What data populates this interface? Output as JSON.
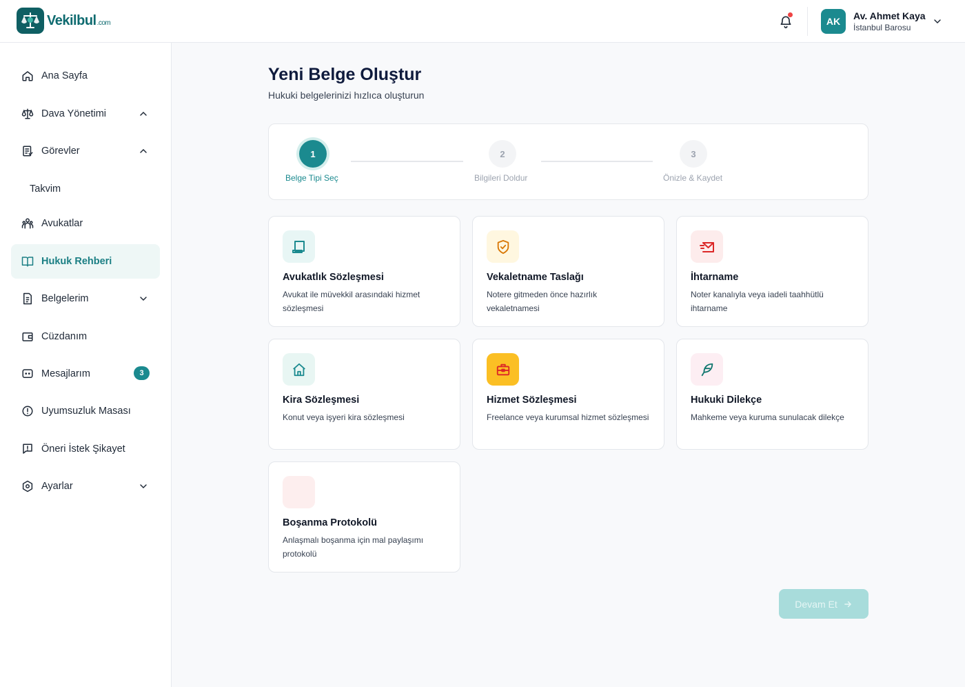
{
  "header": {
    "logo_text": "Vekilbul",
    "logo_suffix": ".com",
    "user": {
      "initials": "AK",
      "name": "Av. Ahmet Kaya",
      "subtitle": "İstanbul Barosu"
    }
  },
  "sidebar": {
    "items": [
      {
        "label": "Ana Sayfa",
        "icon": "home-icon"
      },
      {
        "label": "Dava Yönetimi",
        "icon": "scale-icon",
        "chevron": "up"
      },
      {
        "label": "Görevler",
        "icon": "tasks-icon",
        "chevron": "up"
      },
      {
        "label": "Takvim"
      },
      {
        "label": "Avukatlar",
        "icon": "users-icon"
      },
      {
        "label": "Hukuk Rehberi",
        "icon": "book-icon",
        "active": true
      },
      {
        "label": "Belgelerim",
        "icon": "document-icon",
        "chevron": "down"
      },
      {
        "label": "Cüzdanım",
        "icon": "wallet-icon"
      },
      {
        "label": "Mesajlarım",
        "icon": "message-icon",
        "badge": "3"
      },
      {
        "label": "Uyumsuzluk Masası",
        "icon": "alert-circle-icon"
      },
      {
        "label": "Öneri İstek Şikayet",
        "icon": "feedback-icon"
      },
      {
        "label": "Ayarlar",
        "icon": "settings-icon",
        "chevron": "down"
      }
    ]
  },
  "main": {
    "title": "Yeni Belge Oluştur",
    "subtitle": "Hukuki belgelerinizi hızlıca oluşturun",
    "steps": [
      {
        "number": "1",
        "label": "Belge Tipi Seç",
        "state": "active"
      },
      {
        "number": "2",
        "label": "Bilgileri Doldur",
        "state": "idle"
      },
      {
        "number": "3",
        "label": "Önizle & Kaydet",
        "state": "idle"
      }
    ],
    "cards": [
      {
        "title": "Avukatlık Sözleşmesi",
        "description": "Avukat ile müvekkil arasındaki hizmet sözleşmesi",
        "icon": "contract-icon",
        "icon_color": "#1b8a8f",
        "icon_bg": "#e8f6f5"
      },
      {
        "title": "Vekaletname Taslağı",
        "description": "Notere gitmeden önce hazırlık vekaletnamesi",
        "icon": "shield-check-icon",
        "icon_color": "#d97706",
        "icon_bg": "#fff7e0"
      },
      {
        "title": "İhtarname",
        "description": "Noter kanalıyla veya iadeli taahhütlü ihtarname",
        "icon": "mail-send-icon",
        "icon_color": "#dc2626",
        "icon_bg": "#fdecec"
      },
      {
        "title": "Kira Sözleşmesi",
        "description": "Konut veya işyeri kira sözleşmesi",
        "icon": "house-icon",
        "icon_color": "#1b8a8f",
        "icon_bg": "#e8f6f3"
      },
      {
        "title": "Hizmet Sözleşmesi",
        "description": "Freelance veya kurumsal hizmet sözleşmesi",
        "icon": "briefcase-icon",
        "icon_color": "#dc2626",
        "icon_bg": "#fbbf24"
      },
      {
        "title": "Hukuki Dilekçe",
        "description": "Mahkeme veya kuruma sunulacak dilekçe",
        "icon": "feather-icon",
        "icon_color": "#0f766e",
        "icon_bg": "#fdeef3"
      },
      {
        "title": "Boşanma Protokolü",
        "description": "Anlaşmalı boşanma için mal paylaşımı protokolü",
        "icon": "blank-icon",
        "icon_color": "#fca5a5",
        "icon_bg": "#fdeeee"
      }
    ],
    "continue_label": "Devam Et"
  }
}
